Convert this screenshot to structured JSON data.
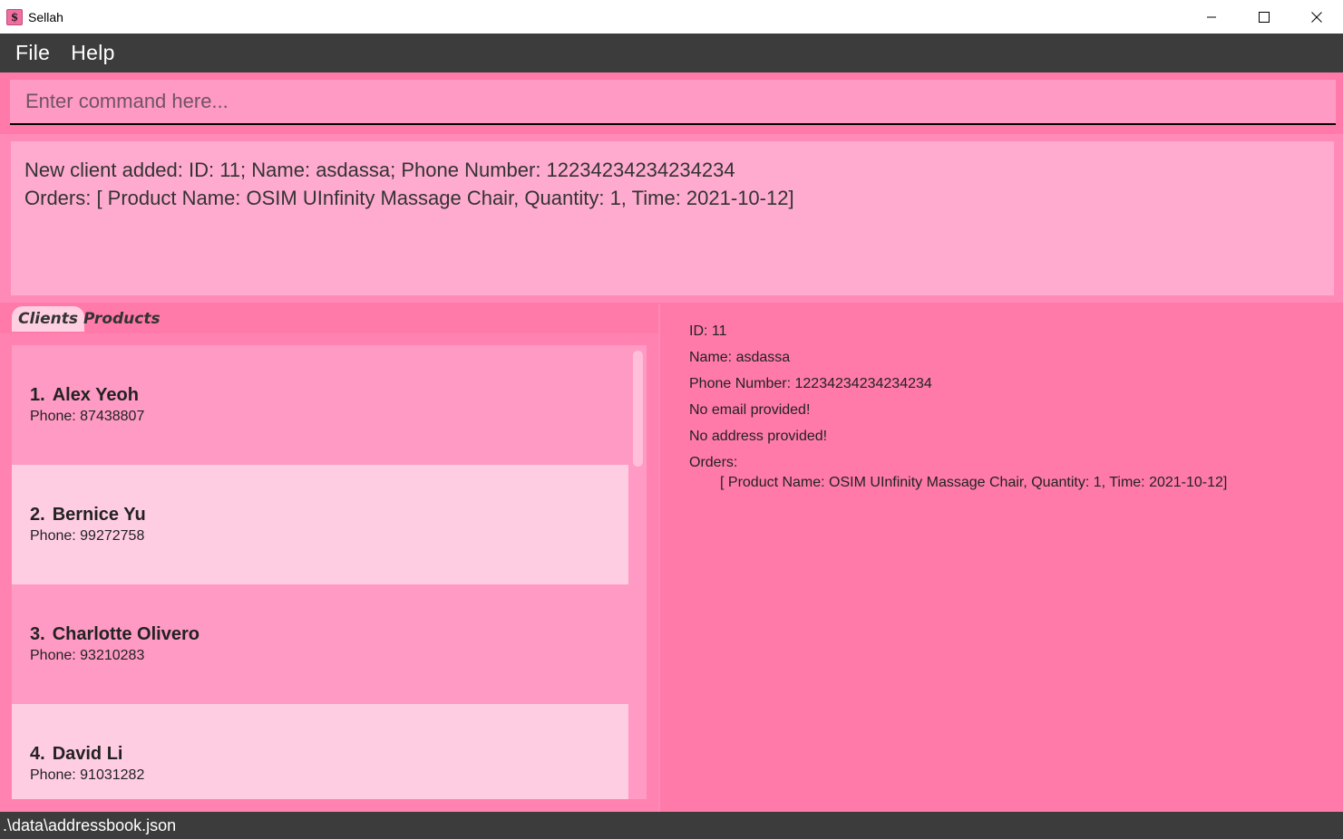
{
  "window": {
    "title": "Sellah",
    "icon_glyph": "$"
  },
  "menu": {
    "items": [
      "File",
      "Help"
    ]
  },
  "command": {
    "placeholder": "Enter command here..."
  },
  "result": {
    "line1": "New client added: ID: 11; Name: asdassa; Phone Number: 12234234234234234",
    "line2": "Orders: [ Product Name: OSIM UInfinity Massage Chair, Quantity: 1, Time: 2021-10-12]"
  },
  "tabs": [
    {
      "label": "Clients",
      "active": true
    },
    {
      "label": "Products",
      "active": false
    }
  ],
  "clients": [
    {
      "index": "1.",
      "name": "Alex Yeoh",
      "phone": "Phone: 87438807"
    },
    {
      "index": "2.",
      "name": "Bernice Yu",
      "phone": "Phone: 99272758"
    },
    {
      "index": "3.",
      "name": "Charlotte Olivero",
      "phone": "Phone: 93210283"
    },
    {
      "index": "4.",
      "name": "David Li",
      "phone": "Phone: 91031282"
    }
  ],
  "detail": {
    "id": "ID: 11",
    "name": "Name: asdassa",
    "phone": "Phone Number: 12234234234234234",
    "email": "No email provided!",
    "address": "No address provided!",
    "orders_label": "Orders:",
    "order_line": "[ Product Name: OSIM UInfinity Massage Chair, Quantity: 1, Time: 2021-10-12]"
  },
  "status": {
    "path": ".\\data\\addressbook.json"
  },
  "colors": {
    "background": "#ff7aa8",
    "menubar": "#3c3c3c",
    "command_bg": "#ff9ac4",
    "result_bg": "#ffabcf",
    "card_even": "#ff9ac4",
    "card_odd": "#ffcde2"
  }
}
